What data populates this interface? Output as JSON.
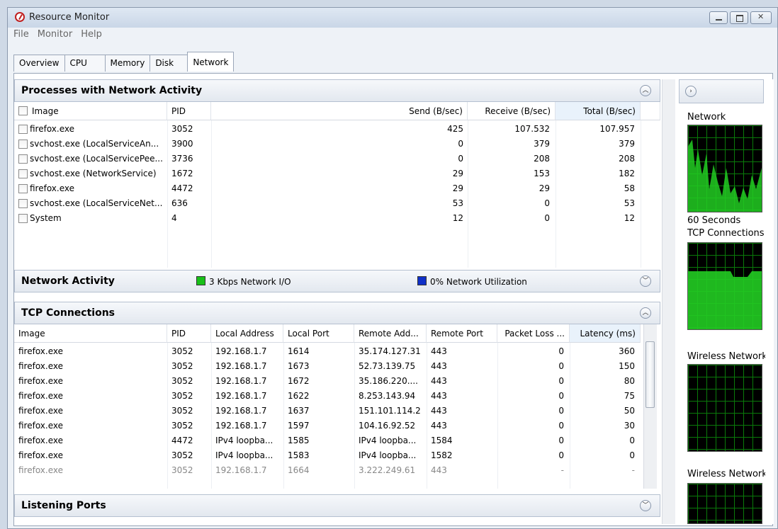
{
  "window": {
    "title": "Resource Monitor"
  },
  "menu": [
    "File",
    "Monitor",
    "Help"
  ],
  "tabs": [
    {
      "label": "Overview",
      "active": false
    },
    {
      "label": "CPU",
      "active": false
    },
    {
      "label": "Memory",
      "active": false
    },
    {
      "label": "Disk",
      "active": false
    },
    {
      "label": "Network",
      "active": true
    }
  ],
  "processes": {
    "title": "Processes with Network Activity",
    "columns": [
      "Image",
      "PID",
      "Send (B/sec)",
      "Receive (B/sec)",
      "Total (B/sec)"
    ],
    "rows": [
      [
        "firefox.exe",
        "3052",
        "425",
        "107.532",
        "107.957"
      ],
      [
        "svchost.exe (LocalServiceAn...",
        "3900",
        "0",
        "379",
        "379"
      ],
      [
        "svchost.exe (LocalServicePee...",
        "3736",
        "0",
        "208",
        "208"
      ],
      [
        "svchost.exe (NetworkService)",
        "1672",
        "29",
        "153",
        "182"
      ],
      [
        "firefox.exe",
        "4472",
        "29",
        "29",
        "58"
      ],
      [
        "svchost.exe (LocalServiceNet...",
        "636",
        "53",
        "0",
        "53"
      ],
      [
        "System",
        "4",
        "12",
        "0",
        "12"
      ]
    ]
  },
  "network_activity": {
    "title": "Network Activity",
    "io": "3 Kbps Network I/O",
    "utilization": "0% Network Utilization",
    "io_color": "#18c018",
    "util_color": "#1030c8"
  },
  "tcp": {
    "title": "TCP Connections",
    "columns": [
      "Image",
      "PID",
      "Local Address",
      "Local Port",
      "Remote Add...",
      "Remote Port",
      "Packet Loss ...",
      "Latency (ms)"
    ],
    "rows": [
      [
        "firefox.exe",
        "3052",
        "192.168.1.7",
        "1614",
        "35.174.127.31",
        "443",
        "0",
        "360"
      ],
      [
        "firefox.exe",
        "3052",
        "192.168.1.7",
        "1673",
        "52.73.139.75",
        "443",
        "0",
        "150"
      ],
      [
        "firefox.exe",
        "3052",
        "192.168.1.7",
        "1672",
        "35.186.220....",
        "443",
        "0",
        "80"
      ],
      [
        "firefox.exe",
        "3052",
        "192.168.1.7",
        "1622",
        "8.253.143.94",
        "443",
        "0",
        "75"
      ],
      [
        "firefox.exe",
        "3052",
        "192.168.1.7",
        "1637",
        "151.101.114.2",
        "443",
        "0",
        "50"
      ],
      [
        "firefox.exe",
        "3052",
        "192.168.1.7",
        "1597",
        "104.16.92.52",
        "443",
        "0",
        "30"
      ],
      [
        "firefox.exe",
        "4472",
        "IPv4 loopba...",
        "1585",
        "IPv4 loopba...",
        "1584",
        "0",
        "0"
      ],
      [
        "firefox.exe",
        "3052",
        "IPv4 loopba...",
        "1583",
        "IPv4 loopba...",
        "1582",
        "0",
        "0"
      ],
      [
        "firefox.exe",
        "3052",
        "192.168.1.7",
        "1664",
        "3.222.249.61",
        "443",
        "-",
        "-"
      ]
    ]
  },
  "listening": {
    "title": "Listening Ports"
  },
  "side_graphs": {
    "network": "Network",
    "seconds": "60 Seconds",
    "tcp": "TCP Connections",
    "wireless1": "Wireless Network",
    "wireless2": "Wireless Network"
  },
  "icons": {
    "collapse": "chevron-up-icon",
    "expand": "chevron-down-icon",
    "side_toggle": "chevron-right-icon"
  }
}
